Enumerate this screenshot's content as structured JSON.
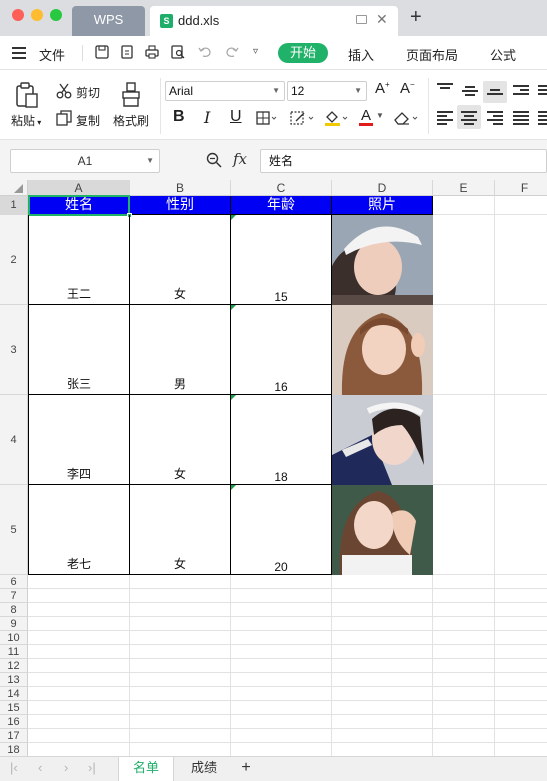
{
  "window": {
    "tabs": [
      {
        "label": "WPS"
      },
      {
        "label": "ddd.xls"
      }
    ],
    "new_tab_label": "+"
  },
  "menu": {
    "hamburger_label": "文件",
    "tabs": [
      "开始",
      "插入",
      "页面布局",
      "公式"
    ]
  },
  "ribbon": {
    "paste_label": "粘贴",
    "cut_label": "剪切",
    "copy_label": "复制",
    "format_painter_label": "格式刷",
    "font_name": "Arial",
    "font_size": "12",
    "bold": "B",
    "italic": "I",
    "underline": "U",
    "grow_font": "A",
    "shrink_font": "A",
    "font_color_label": "A"
  },
  "formula_bar": {
    "cell_ref": "A1",
    "fx_label": "fx",
    "formula_value": "姓名"
  },
  "sheet": {
    "column_headers": [
      "A",
      "B",
      "C",
      "D",
      "E",
      "F"
    ],
    "row_headers": [
      "1",
      "2",
      "3",
      "4",
      "5",
      "6",
      "7",
      "8",
      "9",
      "10",
      "11",
      "12",
      "13",
      "14",
      "15",
      "16",
      "17",
      "18"
    ],
    "table_header": [
      "姓名",
      "性别",
      "年龄",
      "照片"
    ],
    "rows": [
      {
        "name": "王二",
        "gender": "女",
        "age": "15"
      },
      {
        "name": "张三",
        "gender": "男",
        "age": "16"
      },
      {
        "name": "李四",
        "gender": "女",
        "age": "18"
      },
      {
        "name": "老七",
        "gender": "女",
        "age": "20"
      }
    ],
    "colors": {
      "header_fill": "#0000f5",
      "header_text": "#ffffff",
      "selection": "#21b26a"
    }
  },
  "sheet_tabs": {
    "tabs": [
      "名单",
      "成绩"
    ],
    "active": "名单",
    "add_label": "+"
  },
  "colors": {
    "accent": "#21b26a",
    "titlebar": "#dcdde0"
  }
}
